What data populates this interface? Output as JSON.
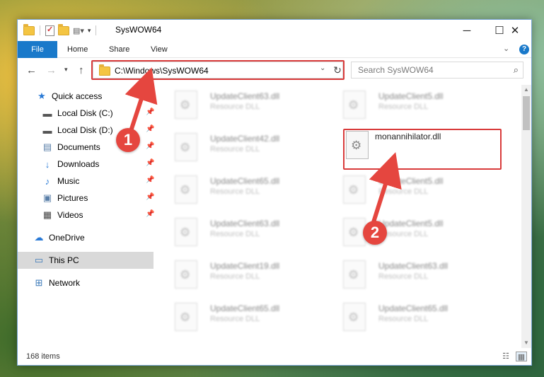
{
  "window": {
    "title": "SysWOW64",
    "minimize_icon": "minimize-icon",
    "maximize_icon": "maximize-icon",
    "close_icon": "close-icon"
  },
  "ribbon": {
    "tabs": [
      "File",
      "Home",
      "Share",
      "View"
    ]
  },
  "navigation": {
    "back_icon": "arrow-left-icon",
    "forward_icon": "arrow-right-icon",
    "recent_icon": "chevron-down-icon",
    "up_icon": "arrow-up-icon",
    "address": "C:\\Windows\\SysWOW64",
    "search_placeholder": "Search SysWOW64"
  },
  "sidebar": {
    "items": [
      {
        "label": "Quick access",
        "icon": "star-icon"
      },
      {
        "label": "Local Disk (C:)",
        "icon": "drive-icon"
      },
      {
        "label": "Local Disk (D:)",
        "icon": "drive-icon"
      },
      {
        "label": "Documents",
        "icon": "documents-icon"
      },
      {
        "label": "Downloads",
        "icon": "download-icon"
      },
      {
        "label": "Music",
        "icon": "music-icon"
      },
      {
        "label": "Pictures",
        "icon": "pictures-icon"
      },
      {
        "label": "Videos",
        "icon": "videos-icon"
      },
      {
        "label": "OneDrive",
        "icon": "cloud-icon"
      },
      {
        "label": "This PC",
        "icon": "computer-icon"
      },
      {
        "label": "Network",
        "icon": "network-icon"
      }
    ],
    "selected": "This PC"
  },
  "files": {
    "left_column": [
      {
        "name": "UpdateClient63.dll",
        "type": "Resource DLL"
      },
      {
        "name": "UpdateClient42.dll",
        "type": "Resource DLL"
      },
      {
        "name": "UpdateClient65.dll",
        "type": "Resource DLL"
      },
      {
        "name": "UpdateClient63.dll",
        "type": "Resource DLL"
      },
      {
        "name": "UpdateClient19.dll",
        "type": "Resource DLL"
      },
      {
        "name": "UpdateClient65.dll",
        "type": "Resource DLL"
      }
    ],
    "right_column": [
      {
        "name": "UpdateClient5.dll",
        "type": "Resource DLL"
      },
      {
        "name": "monannihilator.dll",
        "type": ""
      },
      {
        "name": "UpdateClient5.dll",
        "type": "Resource DLL"
      },
      {
        "name": "UpdateClient5.dll",
        "type": "Resource DLL"
      },
      {
        "name": "UpdateClient63.dll",
        "type": "Resource DLL"
      },
      {
        "name": "UpdateClient65.dll",
        "type": "Resource DLL"
      }
    ]
  },
  "status": {
    "item_count": "168 items"
  },
  "callouts": {
    "first": "1",
    "second": "2"
  },
  "colors": {
    "accent": "#1979ca",
    "highlight": "#d93b3b",
    "callout": "#e5463f"
  }
}
